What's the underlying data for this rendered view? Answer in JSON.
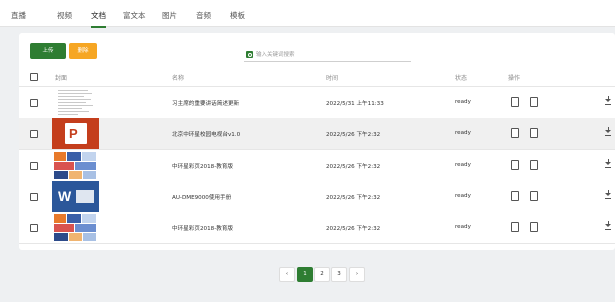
{
  "tabs": [
    "直播",
    "视频",
    "文档",
    "富文本",
    "图片",
    "音频",
    "模板"
  ],
  "active_tab": 2,
  "toolbar": {
    "upload_label": "上传",
    "delete_label": "删除"
  },
  "search": {
    "placeholder": "输入关键词搜索"
  },
  "table": {
    "headers": {
      "cover": "封面",
      "name": "名称",
      "time": "时间",
      "status": "状态",
      "actions": "操作"
    },
    "rows": [
      {
        "thumb": "doc-page",
        "name": "习主席的重要讲话简述更新",
        "time": "2022/5/31 上午11:33",
        "status": "ready"
      },
      {
        "thumb": "powerpoint-icon",
        "name": "北京中环星校园电视台v1.0",
        "time": "2022/5/26 下午2:32",
        "status": "ready"
      },
      {
        "thumb": "collage",
        "name": "中环星彩页2018-教育版",
        "time": "2022/5/26 下午2:32",
        "status": "ready"
      },
      {
        "thumb": "word-icon",
        "name": "AU-DME9000使用手册",
        "time": "2022/5/26 下午2:32",
        "status": "ready"
      },
      {
        "thumb": "collage",
        "name": "中环星彩页2018-教育版",
        "time": "2022/5/26 下午2:32",
        "status": "ready"
      }
    ]
  },
  "pagination": {
    "prev": "‹",
    "pages": [
      "1",
      "2",
      "3"
    ],
    "current": "1",
    "next": "›"
  },
  "colors": {
    "accent": "#2e7d32",
    "warning": "#f6a623",
    "ppt": "#c43e1c",
    "word": "#2b579a"
  },
  "icons": {
    "edit": "edit-icon",
    "copy": "copy-icon",
    "download": "download-icon",
    "search": "search-icon"
  }
}
